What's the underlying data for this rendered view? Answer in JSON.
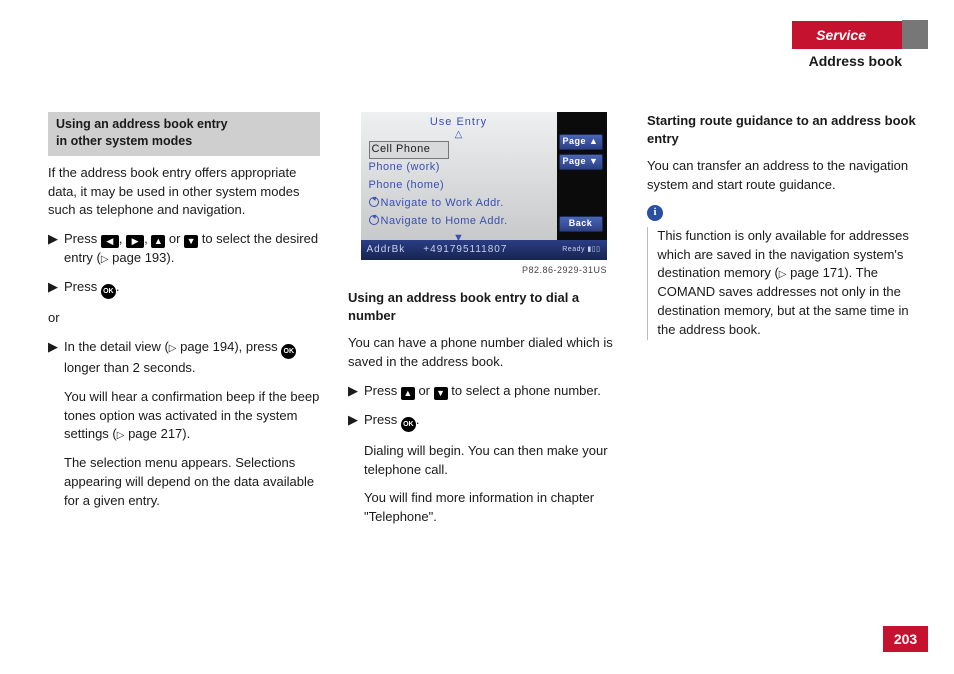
{
  "header": {
    "service_tab": "Service",
    "section": "Address book"
  },
  "page_number": "203",
  "col1": {
    "heading_l1": "Using an address book entry",
    "heading_l2": "in other system modes",
    "intro": "If the address book entry offers appropriate data, it may be used in other system modes such as telephone and navigation.",
    "step1_a": "Press ",
    "step1_b": ", ",
    "step1_c": ", ",
    "step1_d": " or ",
    "step1_e": " to select the desired entry (",
    "step1_ref": " page 193).",
    "step2_a": "Press ",
    "step2_b": ".",
    "or": "or",
    "step3_a": "In the detail view (",
    "step3_ref": " page 194), press ",
    "step3_b": " longer than 2 seconds.",
    "note1": "You will hear a confirmation beep if the beep tones option was activated in the system settings (",
    "note1_ref": " page 217).",
    "note2": "The selection menu appears. Selections appearing will depend on the data available for a given entry."
  },
  "figure": {
    "title": "Use  Entry",
    "item_sel": "Cell  Phone",
    "item2": "Phone  (work)",
    "item3": "Phone  (home)",
    "item4": "Navigate  to  Work  Addr.",
    "item5": "Navigate  to  Home  Addr.",
    "side_pageup": "Page ▲",
    "side_pagedn": "Page ▼",
    "side_back": "Back",
    "footer_left": "AddrBk",
    "footer_num": "+491795111807",
    "footer_ready": "Ready",
    "caption": "P82.86-2929-31US"
  },
  "col2": {
    "heading": "Using an address book entry to dial a number",
    "intro": "You can have a phone number dialed which is saved in the address book.",
    "step1_a": "Press ",
    "step1_b": " or ",
    "step1_c": " to select a phone number.",
    "step2_a": "Press ",
    "step2_b": ".",
    "note1": "Dialing will begin. You can then make your telephone call.",
    "note2": "You will find more information in chapter \"Telephone\"."
  },
  "col3": {
    "heading": "Starting route guidance to an address book entry",
    "intro": "You can transfer an address to the navigation system and start route guidance.",
    "info": "This function is only available for addresses which are saved in the navigation system's destination memory (",
    "info_ref": " page 171). The COMAND saves addresses not only in the destination memory, but at the same time in the address book."
  }
}
